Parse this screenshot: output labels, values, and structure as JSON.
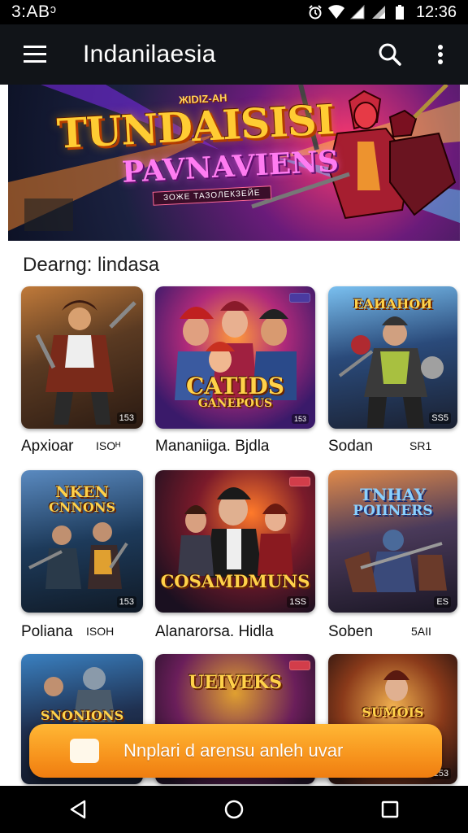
{
  "status_bar": {
    "left_time": "3:ABᵓ",
    "clock": "12:36"
  },
  "app_bar": {
    "title": "Indanilaesia",
    "icons": [
      "menu-icon",
      "search-icon",
      "more-vert-icon"
    ]
  },
  "banner": {
    "kicker": "ЖIDIZ-AH",
    "title": "TUNDAISISI",
    "subtitle": "PAVNAVIENS",
    "tag": "ЗОЖЕ ТАЗОЛЕКЗЕЙЕ"
  },
  "section": {
    "title": "Dearng: lindasa"
  },
  "games": [
    {
      "label": "Apxioar",
      "meta": "ISOᴴ",
      "count": "153",
      "logo": "",
      "palette": [
        "#6a3b1f",
        "#d88a3a"
      ]
    },
    {
      "label": "Mananiiga. Bjdla",
      "meta": "",
      "count": "153",
      "logo": "CATIDS",
      "logo_sub": "GANEPOUS",
      "palette": [
        "#4a1c70",
        "#ff7b2a"
      ]
    },
    {
      "label": "Sodan",
      "meta": "SR1",
      "count": "SS5",
      "logo": "ЕАИАНОИ",
      "palette": [
        "#2b4a73",
        "#7bc0e8"
      ]
    },
    {
      "label": "Poliana",
      "meta": "ISOH",
      "count": "153",
      "logo": "NKEN",
      "logo_sub": "CNNONS",
      "palette": [
        "#1d3a5a",
        "#e7a93a"
      ]
    },
    {
      "label": "Alanarorsa. Hidla",
      "meta": "",
      "count": "1SS",
      "logo": "COSAMDMUNS",
      "palette": [
        "#3a1d38",
        "#ff6a2a"
      ]
    },
    {
      "label": "Soben",
      "meta": "5AII",
      "count": "ES",
      "logo": "TNHAY",
      "logo_sub": "POIINERS",
      "palette": [
        "#3a3050",
        "#c96a3a"
      ]
    },
    {
      "label": "",
      "meta": "",
      "count": "",
      "logo": "SNONIONS",
      "palette": [
        "#1f3050",
        "#3aa0d0"
      ]
    },
    {
      "label": "",
      "meta": "",
      "count": "",
      "logo": "UEIVEKS",
      "palette": [
        "#3a1e4a",
        "#e0a030"
      ]
    },
    {
      "label": "",
      "meta": "",
      "count": "153",
      "logo": "SUMOIS",
      "palette": [
        "#5a2a1a",
        "#f0b050"
      ]
    }
  ],
  "cta": {
    "text": "Nnplari d arensu anleh uvar"
  },
  "nav": {
    "icons": [
      "back-icon",
      "home-icon",
      "recents-icon"
    ]
  },
  "colors": {
    "app_bar": "#111418",
    "accent": "#f7941d"
  }
}
